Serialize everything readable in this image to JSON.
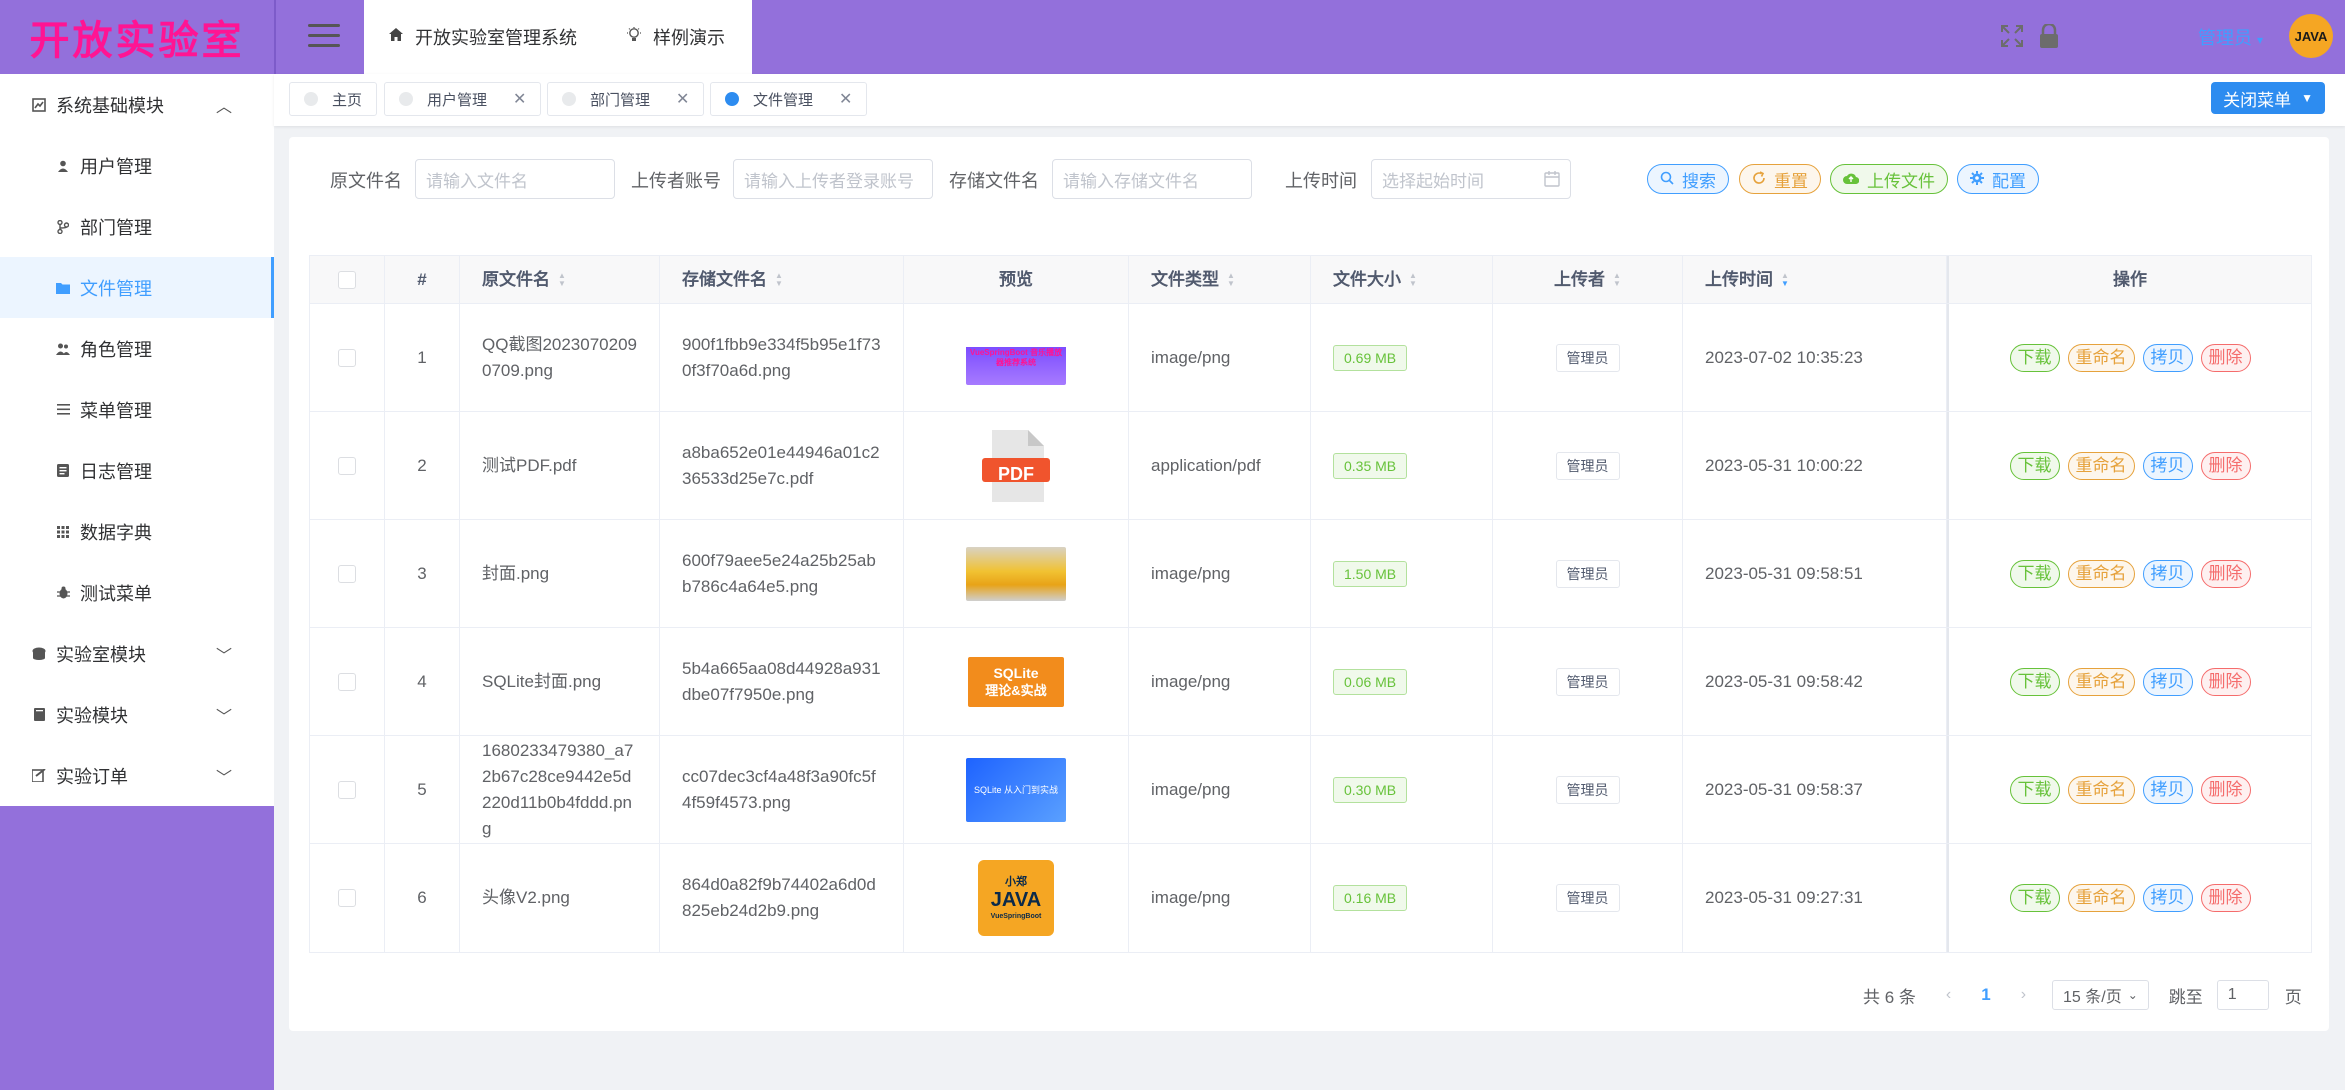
{
  "app": {
    "logo": "开放实验室"
  },
  "header": {
    "tabs": [
      {
        "label": "开放实验室管理系统",
        "icon": "home-icon"
      },
      {
        "label": "样例演示",
        "icon": "lightbulb-icon"
      }
    ],
    "user": {
      "name": "管理员",
      "avatar_text": "JAVA"
    }
  },
  "sidebar": {
    "items": [
      {
        "label": "系统基础模块",
        "icon": "dashboard-icon",
        "type": "group",
        "expanded": true
      },
      {
        "label": "用户管理",
        "icon": "user-icon",
        "type": "sub"
      },
      {
        "label": "部门管理",
        "icon": "department-icon",
        "type": "sub"
      },
      {
        "label": "文件管理",
        "icon": "folder-icon",
        "type": "sub",
        "active": true
      },
      {
        "label": "角色管理",
        "icon": "role-icon",
        "type": "sub"
      },
      {
        "label": "菜单管理",
        "icon": "menu-icon",
        "type": "sub"
      },
      {
        "label": "日志管理",
        "icon": "log-icon",
        "type": "sub"
      },
      {
        "label": "数据字典",
        "icon": "grid-icon",
        "type": "sub"
      },
      {
        "label": "测试菜单",
        "icon": "bug-icon",
        "type": "sub"
      },
      {
        "label": "实验室模块",
        "icon": "lab-icon",
        "type": "group"
      },
      {
        "label": "实验模块",
        "icon": "book-icon",
        "type": "group"
      },
      {
        "label": "实验订单",
        "icon": "order-icon",
        "type": "group"
      }
    ]
  },
  "tagsbar": {
    "tags": [
      {
        "label": "主页",
        "closable": false
      },
      {
        "label": "用户管理",
        "closable": true
      },
      {
        "label": "部门管理",
        "closable": true
      },
      {
        "label": "文件管理",
        "closable": true,
        "active": true
      }
    ],
    "close_menu": "关闭菜单"
  },
  "search": {
    "orig_label": "原文件名",
    "orig_placeholder": "请输入文件名",
    "uploader_label": "上传者账号",
    "uploader_placeholder": "请输入上传者登录账号",
    "stored_label": "存储文件名",
    "stored_placeholder": "请输入存储文件名",
    "time_label": "上传时间",
    "time_placeholder": "选择起始时间",
    "btn_search": "搜索",
    "btn_reset": "重置",
    "btn_upload": "上传文件",
    "btn_config": "配置"
  },
  "table": {
    "headers": {
      "idx": "#",
      "orig": "原文件名",
      "stored": "存储文件名",
      "preview": "预览",
      "type": "文件类型",
      "size": "文件大小",
      "uploader": "上传者",
      "time": "上传时间",
      "ops": "操作"
    },
    "ops": {
      "download": "下载",
      "rename": "重命名",
      "copy": "拷贝",
      "delete": "删除"
    },
    "rows": [
      {
        "idx": "1",
        "orig": "QQ截图20230702090709.png",
        "stored": "900f1fbb9e334f5b95e1f730f3f70a6d.png",
        "preview": "qq",
        "type": "image/png",
        "size": "0.69 MB",
        "uploader": "管理员",
        "time": "2023-07-02 10:35:23"
      },
      {
        "idx": "2",
        "orig": "测试PDF.pdf",
        "stored": "a8ba652e01e44946a01c236533d25e7c.pdf",
        "preview": "pdf",
        "type": "application/pdf",
        "size": "0.35 MB",
        "uploader": "管理员",
        "time": "2023-05-31 10:00:22"
      },
      {
        "idx": "3",
        "orig": "封面.png",
        "stored": "600f79aee5e24a25b25abb786c4a64e5.png",
        "preview": "food",
        "type": "image/png",
        "size": "1.50 MB",
        "uploader": "管理员",
        "time": "2023-05-31 09:58:51"
      },
      {
        "idx": "4",
        "orig": "SQLite封面.png",
        "stored": "5b4a665aa08d44928a931dbe07f7950e.png",
        "preview": "sqlite",
        "type": "image/png",
        "size": "0.06 MB",
        "uploader": "管理员",
        "time": "2023-05-31 09:58:42"
      },
      {
        "idx": "5",
        "orig": "1680233479380_a72b67c28ce9442e5d220d11b0b4fddd.png",
        "stored": "cc07dec3cf4a48f3a90fc5f4f59f4573.png",
        "preview": "course",
        "type": "image/png",
        "size": "0.30 MB",
        "uploader": "管理员",
        "time": "2023-05-31 09:58:37"
      },
      {
        "idx": "6",
        "orig": "头像V2.png",
        "stored": "864d0a82f9b74402a6d0d825eb24d2b9.png",
        "preview": "java",
        "type": "image/png",
        "size": "0.16 MB",
        "uploader": "管理员",
        "time": "2023-05-31 09:27:31"
      }
    ]
  },
  "pagination": {
    "total": "共 6 条",
    "current": "1",
    "page_size": "15 条/页",
    "jump_label": "跳至",
    "jump_value": "1",
    "page_suffix": "页"
  },
  "thumbs": {
    "qq_text": "VueSpringBoot 音乐播放器推荐系统",
    "pdf_text": "PDF",
    "sqlite_line1": "SQLite",
    "sqlite_line2": "理论&实战",
    "course_text": "SQLite 从入门到实战",
    "java_top": "小郑",
    "java_main": "JAVA",
    "java_bottom": "VueSpringBoot"
  },
  "colors": {
    "sidebar_bg": "#9370db",
    "accent": "#409eff",
    "logo": "#ff1493"
  }
}
